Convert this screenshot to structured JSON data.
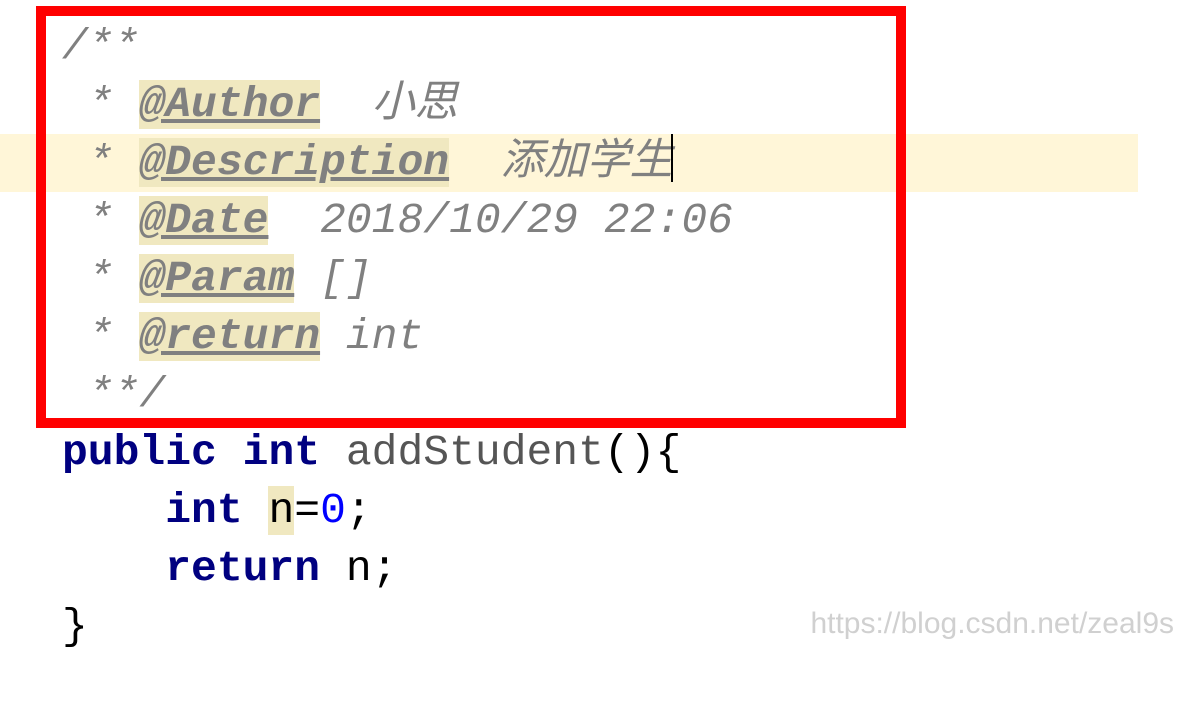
{
  "comment": {
    "open": "/**",
    "star": " *",
    "author_tag": "@Author",
    "author_val": "小思",
    "desc_tag": "@Description",
    "desc_val": "添加学生",
    "date_tag": "@Date",
    "date_val": "2018/10/29 22:06",
    "param_tag": "@Param",
    "param_val": "[]",
    "return_tag": "@return",
    "return_val": "int",
    "close": " **/"
  },
  "code": {
    "kw_public": "public",
    "kw_int": "int",
    "fn_name": "addStudent",
    "parens": "(){",
    "kw_int2": "int",
    "var_n": "n",
    "eq": "=",
    "zero": "0",
    "semi": ";",
    "kw_return": "return",
    "var_n2": "n",
    "semi2": ";",
    "close_brace": "}"
  },
  "watermark": "https://blog.csdn.net/zeal9s"
}
